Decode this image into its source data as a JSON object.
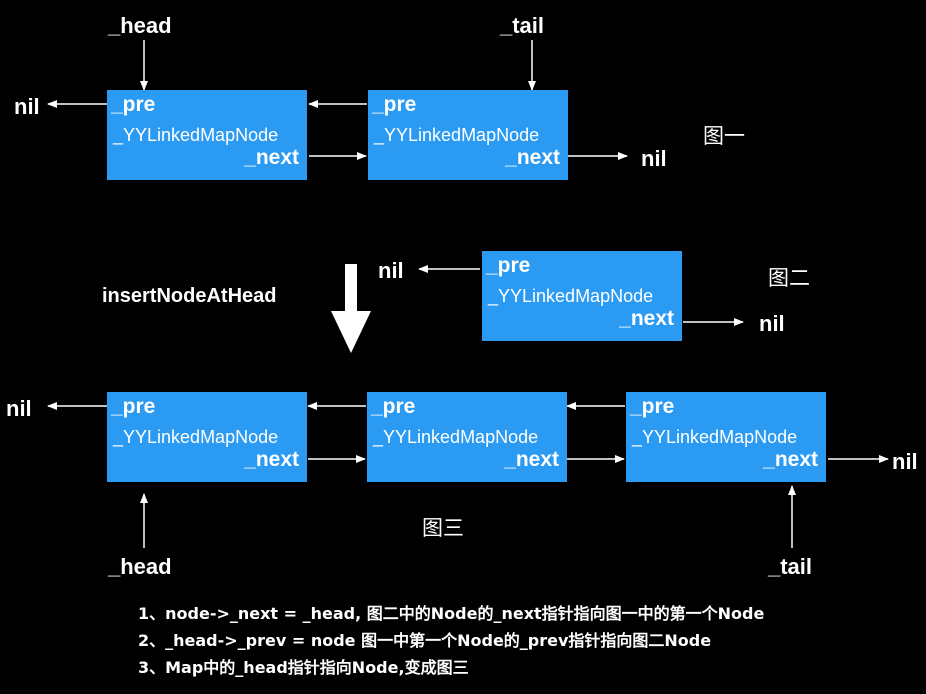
{
  "figure1": {
    "head_label": "_head",
    "tail_label": "_tail",
    "left_nil": "nil",
    "right_nil": "nil",
    "caption": "图一",
    "nodes": [
      {
        "pre": "_pre",
        "name": "_YYLinkedMapNode",
        "next": "_next"
      },
      {
        "pre": "_pre",
        "name": "_YYLinkedMapNode",
        "next": "_next"
      }
    ]
  },
  "operation_label": "insertNodeAtHead",
  "figure2": {
    "left_nil": "nil",
    "right_nil": "nil",
    "caption": "图二",
    "node": {
      "pre": "_pre",
      "name": "_YYLinkedMapNode",
      "next": "_next"
    }
  },
  "figure3": {
    "left_nil": "nil",
    "right_nil": "nil",
    "head_label": "_head",
    "tail_label": "_tail",
    "caption": "图三",
    "nodes": [
      {
        "pre": "_pre",
        "name": "_YYLinkedMapNode",
        "next": "_next"
      },
      {
        "pre": "_pre",
        "name": "_YYLinkedMapNode",
        "next": "_next"
      },
      {
        "pre": "_pre",
        "name": "_YYLinkedMapNode",
        "next": "_next"
      }
    ]
  },
  "notes": [
    "1、node->_next = _head, 图二中的Node的_next指针指向图一中的第一个Node",
    "2、_head->_prev = node  图一中第一个Node的_prev指针指向图二Node",
    "3、Map中的_head指针指向Node,变成图三"
  ],
  "colors": {
    "node_fill": "#2b9af3",
    "background": "#000000",
    "foreground": "#ffffff"
  }
}
